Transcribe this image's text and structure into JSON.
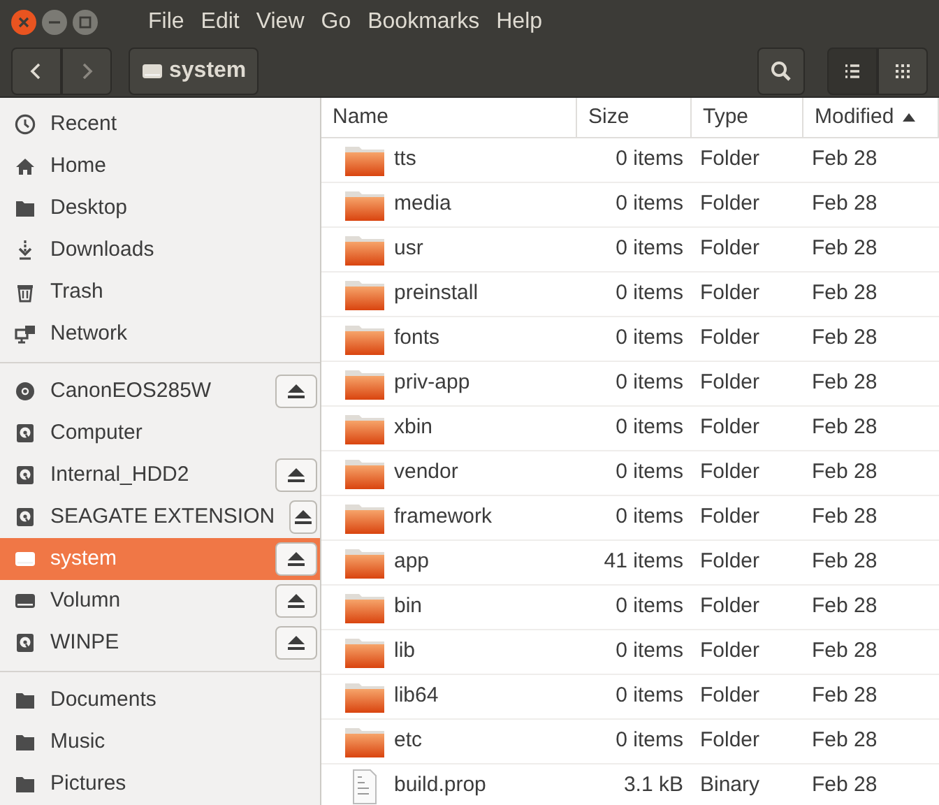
{
  "window": {
    "buttons": [
      {
        "kind": "close"
      },
      {
        "kind": "minimize"
      },
      {
        "kind": "maximize"
      }
    ]
  },
  "menu": [
    "File",
    "Edit",
    "View",
    "Go",
    "Bookmarks",
    "Help"
  ],
  "toolbar": {
    "path_button": {
      "label": "system",
      "kind": "drive"
    },
    "view": [
      {
        "kind": "list",
        "selected": true
      },
      {
        "kind": "grid",
        "selected": false
      }
    ]
  },
  "sidebar": {
    "sections": [
      [
        {
          "label": "Recent",
          "kind": "recent",
          "selected": false,
          "eject": false
        },
        {
          "label": "Home",
          "kind": "home",
          "selected": false,
          "eject": false
        },
        {
          "label": "Desktop",
          "kind": "folder",
          "selected": false,
          "eject": false
        },
        {
          "label": "Downloads",
          "kind": "download",
          "selected": false,
          "eject": false
        },
        {
          "label": "Trash",
          "kind": "trash",
          "selected": false,
          "eject": false
        },
        {
          "label": "Network",
          "kind": "network",
          "selected": false,
          "eject": false
        }
      ],
      [
        {
          "label": "CanonEOS285W",
          "kind": "disc",
          "selected": false,
          "eject": true
        },
        {
          "label": "Computer",
          "kind": "disk",
          "selected": false,
          "eject": false
        },
        {
          "label": "Internal_HDD2",
          "kind": "disk",
          "selected": false,
          "eject": true
        },
        {
          "label": "SEAGATE EXTENSION",
          "kind": "disk",
          "selected": false,
          "eject": true
        },
        {
          "label": "system",
          "kind": "drive",
          "selected": true,
          "eject": true
        },
        {
          "label": "Volumn",
          "kind": "drive",
          "selected": false,
          "eject": true
        },
        {
          "label": "WINPE",
          "kind": "disk",
          "selected": false,
          "eject": true
        }
      ],
      [
        {
          "label": "Documents",
          "kind": "folder",
          "selected": false,
          "eject": false
        },
        {
          "label": "Music",
          "kind": "folder",
          "selected": false,
          "eject": false
        },
        {
          "label": "Pictures",
          "kind": "folder",
          "selected": false,
          "eject": false
        }
      ]
    ]
  },
  "table": {
    "columns": [
      {
        "label": "Name",
        "sorted": false
      },
      {
        "label": "Size",
        "sorted": false
      },
      {
        "label": "Type",
        "sorted": false
      },
      {
        "label": "Modified",
        "sorted": true
      }
    ],
    "rows": [
      {
        "kind": "folder",
        "name": "tts",
        "size": "0 items",
        "type": "Folder",
        "modified": "Feb 28"
      },
      {
        "kind": "folder",
        "name": "media",
        "size": "0 items",
        "type": "Folder",
        "modified": "Feb 28"
      },
      {
        "kind": "folder",
        "name": "usr",
        "size": "0 items",
        "type": "Folder",
        "modified": "Feb 28"
      },
      {
        "kind": "folder",
        "name": "preinstall",
        "size": "0 items",
        "type": "Folder",
        "modified": "Feb 28"
      },
      {
        "kind": "folder",
        "name": "fonts",
        "size": "0 items",
        "type": "Folder",
        "modified": "Feb 28"
      },
      {
        "kind": "folder",
        "name": "priv-app",
        "size": "0 items",
        "type": "Folder",
        "modified": "Feb 28"
      },
      {
        "kind": "folder",
        "name": "xbin",
        "size": "0 items",
        "type": "Folder",
        "modified": "Feb 28"
      },
      {
        "kind": "folder",
        "name": "vendor",
        "size": "0 items",
        "type": "Folder",
        "modified": "Feb 28"
      },
      {
        "kind": "folder",
        "name": "framework",
        "size": "0 items",
        "type": "Folder",
        "modified": "Feb 28"
      },
      {
        "kind": "folder",
        "name": "app",
        "size": "41 items",
        "type": "Folder",
        "modified": "Feb 28"
      },
      {
        "kind": "folder",
        "name": "bin",
        "size": "0 items",
        "type": "Folder",
        "modified": "Feb 28"
      },
      {
        "kind": "folder",
        "name": "lib",
        "size": "0 items",
        "type": "Folder",
        "modified": "Feb 28"
      },
      {
        "kind": "folder",
        "name": "lib64",
        "size": "0 items",
        "type": "Folder",
        "modified": "Feb 28"
      },
      {
        "kind": "folder",
        "name": "etc",
        "size": "0 items",
        "type": "Folder",
        "modified": "Feb 28"
      },
      {
        "kind": "file",
        "name": "build.prop",
        "size": "3.1 kB",
        "type": "Binary",
        "modified": "Feb 28"
      }
    ]
  }
}
